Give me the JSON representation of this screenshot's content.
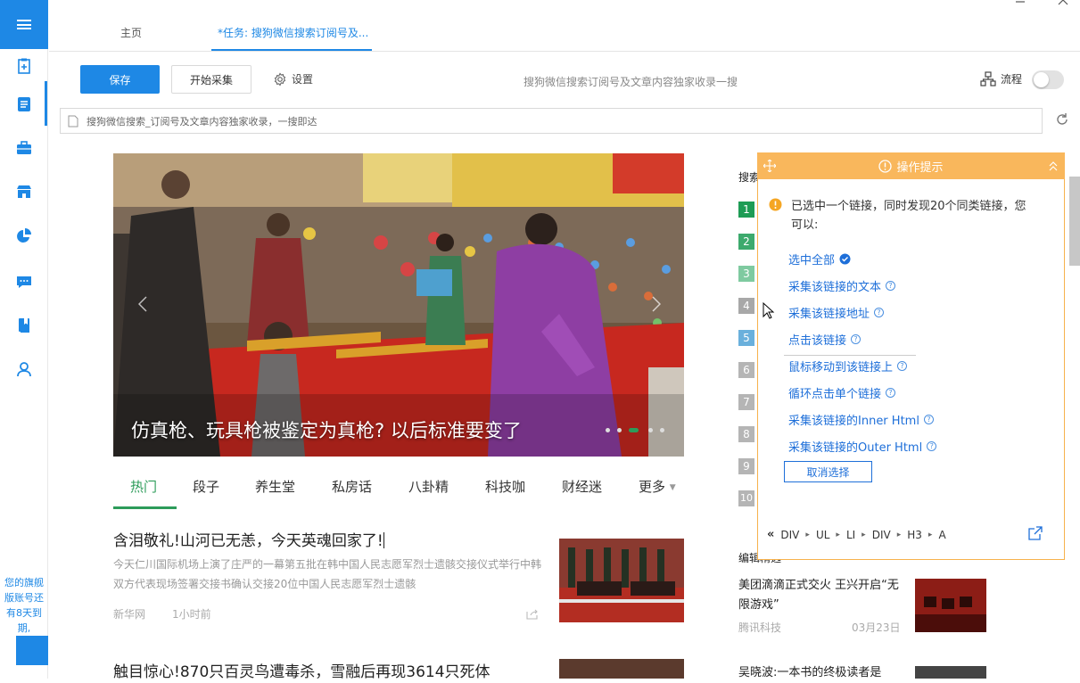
{
  "sidebar": {
    "promo_text": "您的旗舰版账号还有8天到期,"
  },
  "tabs": [
    {
      "label": "主页"
    },
    {
      "label": "*任务: 搜狗微信搜索订阅号及..."
    }
  ],
  "toolbar": {
    "save_label": "保存",
    "start_label": "开始采集",
    "settings_label": "设置",
    "task_desc": "搜狗微信搜索订阅号及文章内容独家收录一搜",
    "flow_label": "流程"
  },
  "address_bar": {
    "value": "搜狗微信搜索_订阅号及文章内容独家收录，一搜即达"
  },
  "hero": {
    "caption": "仿真枪、玩具枪被鉴定为真枪? 以后标准要变了"
  },
  "categories": [
    "热门",
    "段子",
    "养生堂",
    "私房话",
    "八卦精",
    "科技咖",
    "财经迷",
    "更多"
  ],
  "articles": [
    {
      "title": "含泪敬礼!山河已无恙，今天英魂回家了!",
      "summary": "今天仁川国际机场上演了庄严的一幕第五批在韩中国人民志愿军烈士遗骸交接仪式举行中韩双方代表现场签署交接书确认交接20位中国人民志愿军烈士遗骸",
      "source": "新华网",
      "time": "1小时前"
    },
    {
      "title": "触目惊心!870只百灵鸟遭毒杀，雪融后再现3614只死体"
    }
  ],
  "right": {
    "rank_title": "搜索",
    "ranks": [
      "1",
      "2",
      "3",
      "4",
      "5",
      "6",
      "7",
      "8",
      "9",
      "10"
    ],
    "edit_title": "编辑精选",
    "news": [
      {
        "title": "美团滴滴正式交火 王兴开启“无限游戏”",
        "source": "腾讯科技",
        "date": "03月23日"
      },
      {
        "title": "吴晓波:一本书的终极读者是"
      }
    ]
  },
  "tips": {
    "header": "操作提示",
    "message": "已选中一个链接，同时发现20个同类链接，您可以:",
    "links": [
      "选中全部",
      "采集该链接的文本",
      "采集该链接地址",
      "点击该链接",
      "鼠标移动到该链接上",
      "循环点击单个链接",
      "采集该链接的Inner Html",
      "采集该链接的Outer Html"
    ],
    "cancel_label": "取消选择",
    "breadcrumbs": [
      "DIV",
      "UL",
      "LI",
      "DIV",
      "H3",
      "A"
    ]
  }
}
